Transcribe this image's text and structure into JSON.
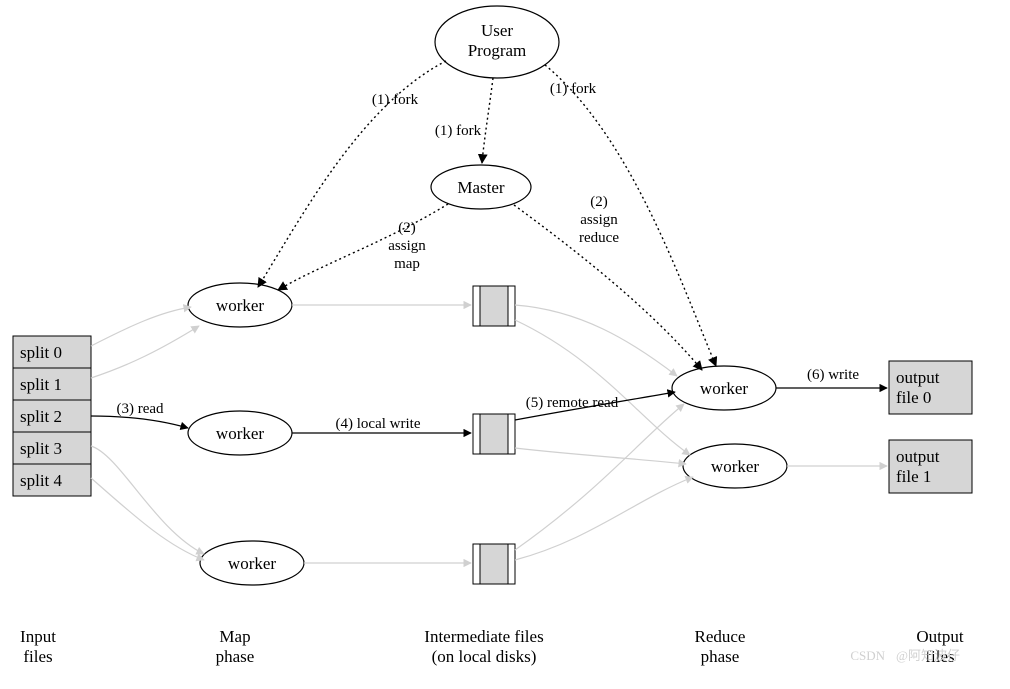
{
  "nodes": {
    "user_program": {
      "line1": "User",
      "line2": "Program"
    },
    "master": "Master",
    "worker_map1": "worker",
    "worker_map2": "worker",
    "worker_map3": "worker",
    "worker_reduce1": "worker",
    "worker_reduce2": "worker"
  },
  "splits": [
    "split 0",
    "split 1",
    "split 2",
    "split 3",
    "split 4"
  ],
  "outputs": [
    {
      "line1": "output",
      "line2": "file 0"
    },
    {
      "line1": "output",
      "line2": "file 1"
    }
  ],
  "edge_labels": {
    "fork_left": "(1) fork",
    "fork_mid": "(1) fork",
    "fork_right": "(1) fork",
    "assign_map": {
      "line1": "(2)",
      "line2": "assign",
      "line3": "map"
    },
    "assign_reduce": {
      "line1": "(2)",
      "line2": "assign",
      "line3": "reduce"
    },
    "read": "(3) read",
    "local_write": "(4) local write",
    "remote_read": "(5) remote read",
    "write": "(6) write"
  },
  "phase_labels": {
    "input": {
      "line1": "Input",
      "line2": "files"
    },
    "map": {
      "line1": "Map",
      "line2": "phase"
    },
    "intermediate": {
      "line1": "Intermediate files",
      "line2": "(on local disks)"
    },
    "reduce": {
      "line1": "Reduce",
      "line2": "phase"
    },
    "output": {
      "line1": "Output",
      "line2": "files"
    }
  },
  "watermark_left": "CSDN",
  "watermark_right": "@阿知波仔"
}
